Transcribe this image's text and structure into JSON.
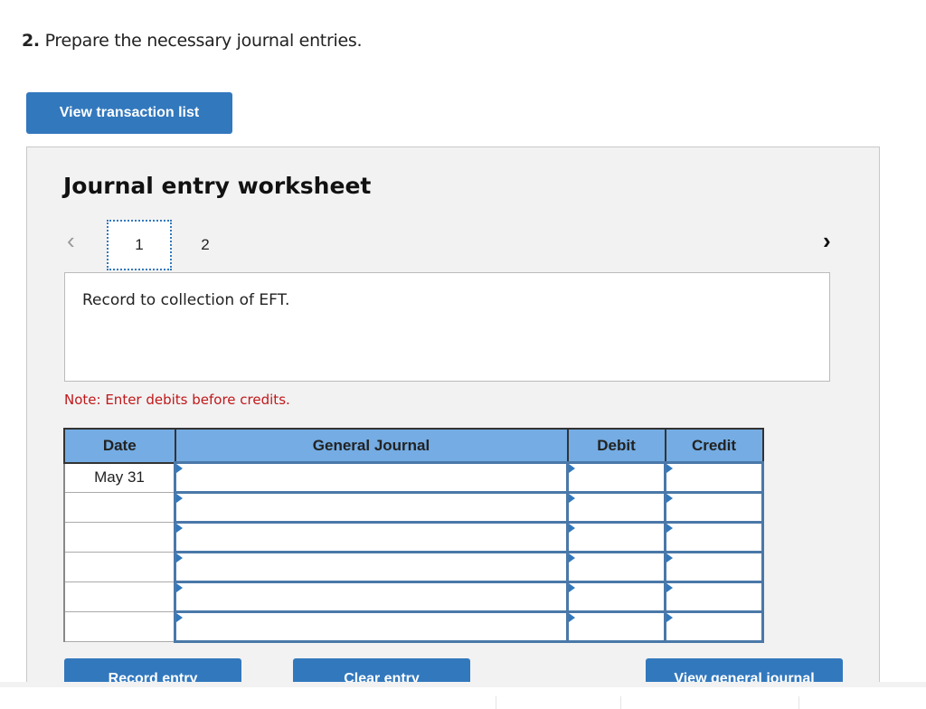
{
  "question": {
    "number": "2.",
    "text": "Prepare the necessary journal entries."
  },
  "buttons": {
    "view_transactions": "View transaction list",
    "record_entry": "Record entry",
    "clear_entry": "Clear entry",
    "view_general_journal": "View general journal"
  },
  "worksheet": {
    "title": "Journal entry worksheet",
    "tabs": [
      "1",
      "2"
    ],
    "active_tab": "1",
    "description": "Record to collection of EFT.",
    "note": "Note: Enter debits before credits."
  },
  "table": {
    "headers": [
      "Date",
      "General Journal",
      "Debit",
      "Credit"
    ],
    "rows": [
      {
        "date": "May 31",
        "account": "",
        "debit": "",
        "credit": ""
      },
      {
        "date": "",
        "account": "",
        "debit": "",
        "credit": ""
      },
      {
        "date": "",
        "account": "",
        "debit": "",
        "credit": ""
      },
      {
        "date": "",
        "account": "",
        "debit": "",
        "credit": ""
      },
      {
        "date": "",
        "account": "",
        "debit": "",
        "credit": ""
      },
      {
        "date": "",
        "account": "",
        "debit": "",
        "credit": ""
      }
    ]
  },
  "icons": {
    "prev": "chevron-left-icon",
    "next": "chevron-right-icon"
  }
}
